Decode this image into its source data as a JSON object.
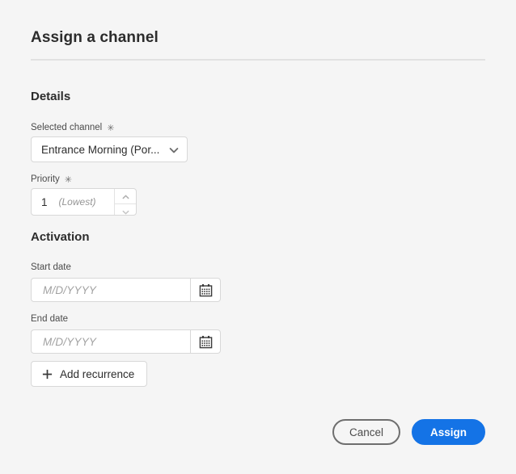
{
  "dialog": {
    "title": "Assign a channel",
    "required_marker": "✳"
  },
  "details": {
    "heading": "Details",
    "selected_channel": {
      "label": "Selected channel",
      "value": "Entrance Morning (Por...",
      "icon": "chevron-down-icon"
    },
    "priority": {
      "label": "Priority",
      "value": "1",
      "hint": "(Lowest)",
      "increment_icon": "chevron-up-icon",
      "decrement_icon": "chevron-down-icon"
    }
  },
  "activation": {
    "heading": "Activation",
    "start_date": {
      "label": "Start date",
      "value": "",
      "placeholder": "M/D/YYYY",
      "icon": "calendar-icon"
    },
    "end_date": {
      "label": "End date",
      "value": "",
      "placeholder": "M/D/YYYY",
      "icon": "calendar-icon"
    },
    "add_recurrence": {
      "label": "Add recurrence",
      "icon": "plus-icon"
    }
  },
  "footer": {
    "cancel_label": "Cancel",
    "assign_label": "Assign"
  },
  "colors": {
    "page_background": "#f5f5f5",
    "accent": "#1473e6",
    "text": "#2c2c2c",
    "border": "#d8d8d8",
    "placeholder": "#a2a2a2"
  }
}
